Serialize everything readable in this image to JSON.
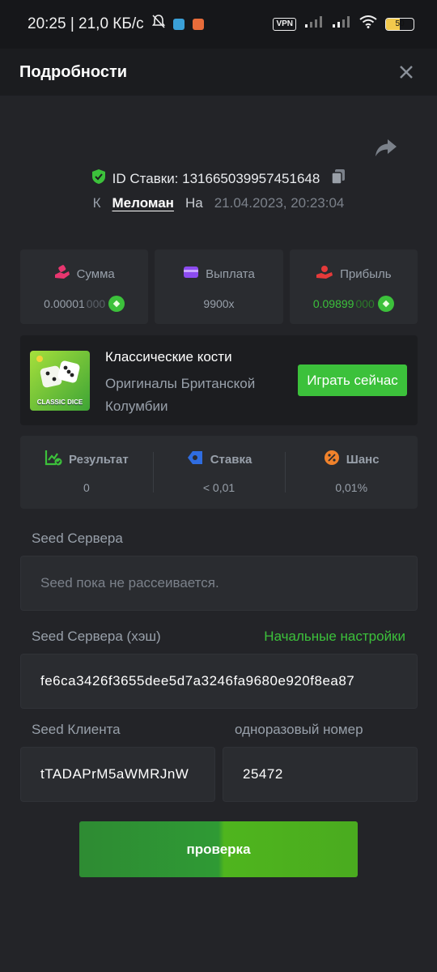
{
  "status_bar": {
    "time_speed": "20:25 | 21,0 КБ/с",
    "vpn": "VPN",
    "battery": "50"
  },
  "header": {
    "title": "Подробности"
  },
  "bet": {
    "id_label": "ID Ставки: 131665039957451648",
    "by_label": "К",
    "user": "Меломан",
    "on_label": "На",
    "date": "21.04.2023, 20:23:04"
  },
  "stats": {
    "amount": {
      "label": "Сумма",
      "value_main": "0.00001",
      "value_dim": "000"
    },
    "payout": {
      "label": "Выплата",
      "value": "9900x"
    },
    "profit": {
      "label": "Прибыль",
      "value_main": "0.09899",
      "value_dim": "000"
    }
  },
  "game": {
    "thumb_text": "CLASSIC DICE",
    "name": "Классические кости",
    "provider": "Оригиналы Британской Колумбии",
    "play_label": "Играть сейчас"
  },
  "results": {
    "result": {
      "label": "Результат",
      "value": "0"
    },
    "bet": {
      "label": "Ставка",
      "value": "< 0,01"
    },
    "chance": {
      "label": "Шанс",
      "value": "0,01%"
    }
  },
  "seeds": {
    "server_label": "Seed Сервера",
    "server_placeholder": "Seed пока не рассеивается.",
    "server_hash_label": "Seed Сервера (хэш)",
    "settings_link": "Начальные настройки",
    "server_hash_value": "fe6ca3426f3655dee5d7a3246fa9680e920f8ea87",
    "client_label": "Seed Клиента",
    "client_value": "tTADAPrM5aWMRJnW",
    "nonce_label": "одноразовый номер",
    "nonce_value": "25472"
  },
  "verify_label": "проверка",
  "colors": {
    "background": "#232428",
    "panel": "#2a2c30",
    "accent_green": "#3cc13b",
    "muted_text": "#98a0aa"
  }
}
